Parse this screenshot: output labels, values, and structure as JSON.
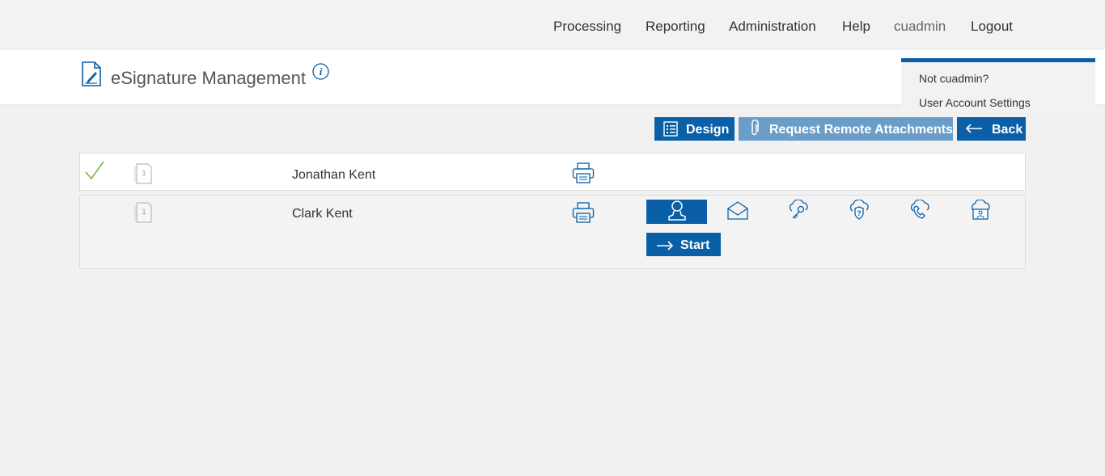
{
  "nav": {
    "items": [
      "Processing",
      "Reporting",
      "Administration",
      "Help",
      "cuadmin",
      "Logout"
    ]
  },
  "header": {
    "title": "eSignature Management"
  },
  "user_menu": {
    "items": [
      "Not cuadmin?",
      "User Account Settings"
    ]
  },
  "toolbar": {
    "design_label": "Design",
    "remote_label": "Request Remote Attachments",
    "back_label": "Back"
  },
  "signers": [
    {
      "name": "Jonathan Kent",
      "status": "completed",
      "doc_count": "1"
    },
    {
      "name": "Clark Kent",
      "status": "pending",
      "doc_count": "1"
    }
  ],
  "actions": {
    "start_label": "Start"
  },
  "auth_methods": [
    "in-person-icon",
    "email-icon",
    "cloud-key-icon",
    "cloud-question-icon",
    "phone-icon",
    "cloud-id-icon"
  ],
  "colors": {
    "accent": "#0a5fa6",
    "accent_light": "#6a9ec8",
    "check": "#7ab648"
  }
}
